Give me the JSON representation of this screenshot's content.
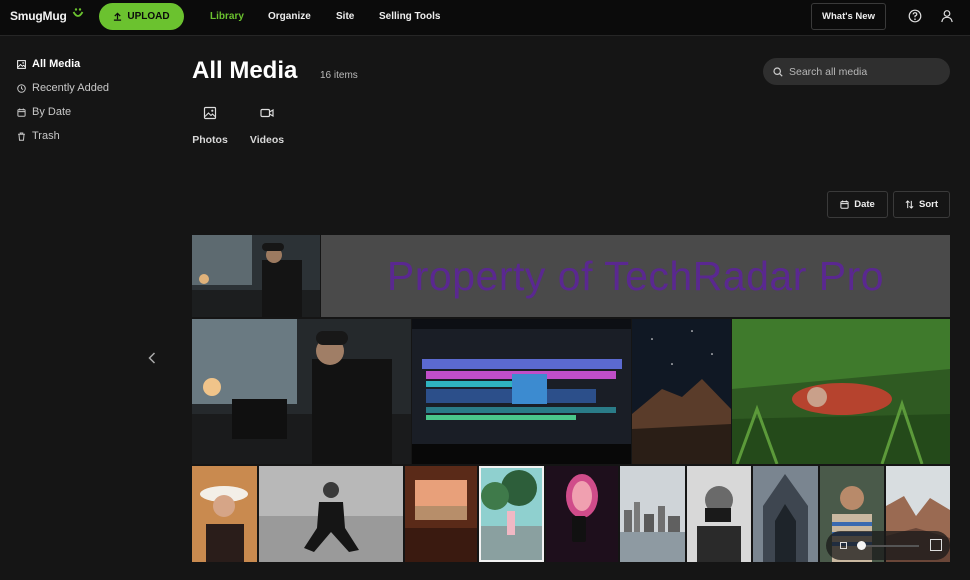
{
  "header": {
    "logo": "SmugMug",
    "upload_label": "UPLOAD",
    "nav": [
      "Library",
      "Organize",
      "Site",
      "Selling Tools"
    ],
    "active_nav": "Library",
    "whats_new_label": "What's New",
    "accent_color": "#6bc22f"
  },
  "sidebar": {
    "items": [
      {
        "label": "All Media",
        "icon": "image-icon",
        "active": true
      },
      {
        "label": "Recently Added",
        "icon": "clock-icon",
        "active": false
      },
      {
        "label": "By Date",
        "icon": "calendar-icon",
        "active": false
      },
      {
        "label": "Trash",
        "icon": "trash-icon",
        "active": false
      }
    ]
  },
  "main": {
    "title": "All Media",
    "count": "16 items",
    "search_placeholder": "Search all media",
    "tabs": [
      {
        "label": "Photos",
        "icon": "photo-icon"
      },
      {
        "label": "Videos",
        "icon": "video-icon"
      }
    ],
    "date_label": "Date",
    "sort_label": "Sort",
    "watermark": "Property of TechRadar Pro",
    "photos": [
      {
        "subject": "man at laptop (small)"
      },
      {
        "subject": "man at laptop"
      },
      {
        "subject": "video editing screen"
      },
      {
        "subject": "mountain at night"
      },
      {
        "subject": "woman lying in grass"
      },
      {
        "subject": "woman with white hat"
      },
      {
        "subject": "woman sitting on sand"
      },
      {
        "subject": "train window"
      },
      {
        "subject": "woman on road",
        "selected": true
      },
      {
        "subject": "airplane window phone"
      },
      {
        "subject": "city skyline water"
      },
      {
        "subject": "man with camera"
      },
      {
        "subject": "cathedral doors"
      },
      {
        "subject": "man in striped shirt"
      },
      {
        "subject": "canyon rocks"
      }
    ]
  }
}
